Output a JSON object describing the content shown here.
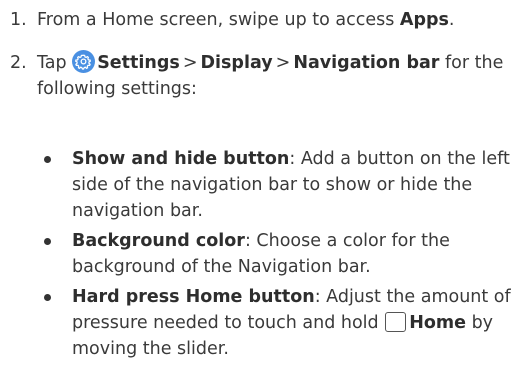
{
  "steps": [
    {
      "number": "1.",
      "prefix": "From a Home screen, swipe up to access ",
      "bold": "Apps",
      "suffix": "."
    },
    {
      "number": "2.",
      "prefix": "Tap ",
      "icon": "settings-gear-icon",
      "path": [
        "Settings",
        "Display",
        "Navigation bar"
      ],
      "separator": ">",
      "suffix": " for the following settings:"
    }
  ],
  "bullets": [
    {
      "title": "Show and hide button",
      "text": ": Add a button on the left side of the navigation bar to show or hide the navigation bar."
    },
    {
      "title": "Background color",
      "text": ": Choose a color for the background of the Navigation bar."
    },
    {
      "title": "Hard press Home button",
      "text_before": ": Adjust the amount of pressure needed to touch and hold ",
      "icon": "home-button-icon",
      "bold_inline": "Home",
      "text_after": " by moving the slider."
    }
  ],
  "colors": {
    "text": "#3a3a3a",
    "settings_icon_bg": "#4a90e2"
  }
}
